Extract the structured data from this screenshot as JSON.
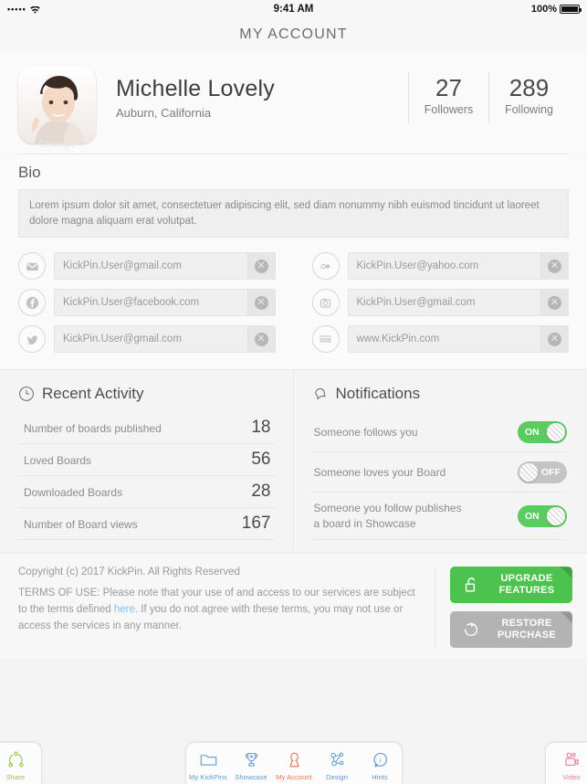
{
  "status_bar": {
    "signal_dots": "•••••",
    "wifi_icon": "wifi-icon",
    "time": "9:41 AM",
    "battery_percent": "100%",
    "battery_icon": "battery-full-icon"
  },
  "nav": {
    "title": "MY ACCOUNT"
  },
  "profile": {
    "avatar_icon": "user-avatar-photo",
    "avatar_change_label": "Change",
    "name": "Michelle Lovely",
    "location": "Auburn, California",
    "stats": [
      {
        "value": "27",
        "label": "Followers"
      },
      {
        "value": "289",
        "label": "Following"
      }
    ]
  },
  "bio": {
    "title": "Bio",
    "text": "Lorem ipsum dolor sit amet, consectetuer adipiscing elit, sed diam nonummy nibh euismod tincidunt ut laoreet dolore magna aliquam erat volutpat."
  },
  "social_fields": [
    {
      "icon": "email-icon",
      "value": "KickPin.User@gmail.com",
      "clear_icon": "clear-circle-icon"
    },
    {
      "icon": "flickr-icon",
      "value": "KickPin.User@yahoo.com",
      "clear_icon": "clear-circle-icon"
    },
    {
      "icon": "facebook-icon",
      "value": "KickPin.User@facebook.com",
      "clear_icon": "clear-circle-icon"
    },
    {
      "icon": "instagram-icon",
      "value": "KickPin.User@gmail.com",
      "clear_icon": "clear-circle-icon"
    },
    {
      "icon": "twitter-icon",
      "value": "KickPin.User@gmail.com",
      "clear_icon": "clear-circle-icon"
    },
    {
      "icon": "www-icon",
      "value": "www.KickPin.com",
      "clear_icon": "clear-circle-icon"
    }
  ],
  "recent_activity": {
    "icon": "clock-icon",
    "title": "Recent Activity",
    "rows": [
      {
        "label": "Number of boards published",
        "value": "18"
      },
      {
        "label": "Loved Boards",
        "value": "56"
      },
      {
        "label": "Downloaded Boards",
        "value": "28"
      },
      {
        "label": "Number of Board views",
        "value": "167"
      }
    ]
  },
  "notifications": {
    "icon": "bell-icon",
    "title": "Notifications",
    "rows": [
      {
        "label": "Someone follows you",
        "state": "ON"
      },
      {
        "label": "Someone loves your Board",
        "state": "OFF"
      },
      {
        "label": "Someone you follow publishes a board in Showcase",
        "state": "ON"
      }
    ]
  },
  "footer": {
    "copyright": "Copyright (c) 2017 KickPin. All Rights Reserved",
    "terms_part1": "TERMS OF USE: Please note that your use of and access to our services are subject to the terms defined ",
    "terms_link": "here",
    "terms_part2": ". If you do not agree with these terms, you may not use or access the services in any manner.",
    "buttons": [
      {
        "icon": "unlock-icon",
        "line1": "UPGRADE",
        "line2": "FEATURES",
        "color": "#4ec24e"
      },
      {
        "icon": "restore-icon",
        "line1": "RESTORE",
        "line2": "PURCHASE",
        "color": "#b3b3b3"
      }
    ]
  },
  "tab_bar": {
    "left": [
      {
        "icon": "share-icon",
        "label": "Share",
        "color": "#9ac54a"
      }
    ],
    "center": [
      {
        "icon": "folder-icon",
        "label": "My KickPins",
        "color": "#5b9bd5",
        "active": false
      },
      {
        "icon": "trophy-icon",
        "label": "Showcase",
        "color": "#5b9bd5",
        "active": false
      },
      {
        "icon": "person-icon",
        "label": "My Account",
        "color": "#e8744c",
        "active": true
      },
      {
        "icon": "nodes-icon",
        "label": "Design",
        "color": "#5b9bd5",
        "active": false
      },
      {
        "icon": "info-icon",
        "label": "Hints",
        "color": "#5b9bd5",
        "active": false
      }
    ],
    "right": [
      {
        "icon": "video-icon",
        "label": "Video",
        "color": "#ef7a9a"
      }
    ]
  },
  "colors": {
    "accent_green": "#5bcc60",
    "toggle_off": "#c4c4c4",
    "link_blue": "#7fc4ea",
    "active_tab": "#e8744c",
    "tab_blue": "#5b9bd5"
  }
}
